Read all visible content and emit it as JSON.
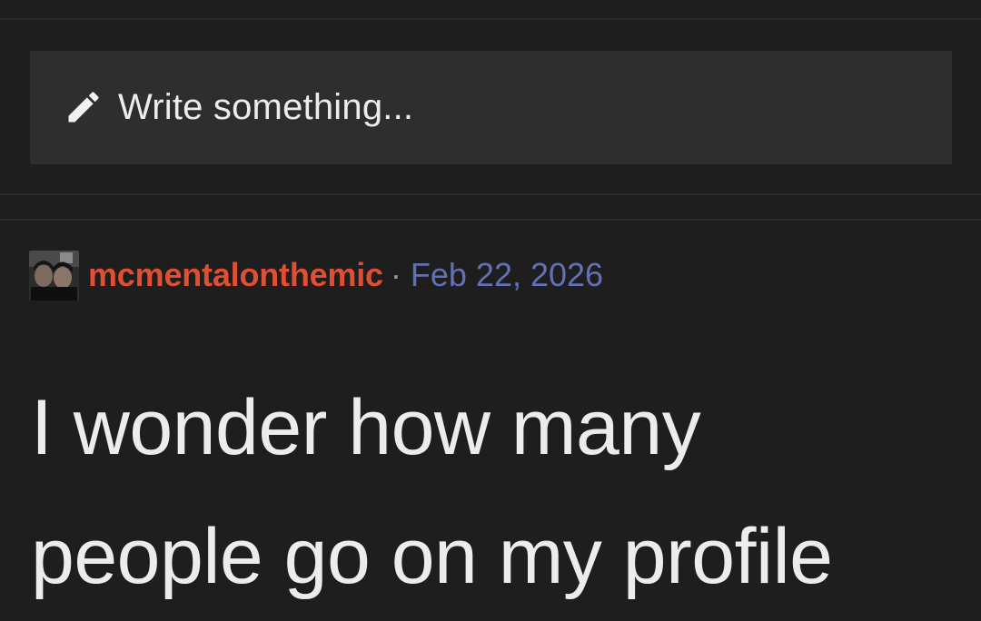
{
  "composer": {
    "placeholder": "Write something...",
    "icon": "pencil-icon"
  },
  "post": {
    "author": "mcmentalonthemic",
    "separator": "·",
    "date": "Feb 22, 2026",
    "text_lines": [
      "I wonder how many",
      "people go on my profile"
    ],
    "avatar": "user-avatar-photo"
  },
  "colors": {
    "background": "#1e1e1e",
    "composer_bg": "#2e2e2e",
    "username": "#e04f34",
    "date": "#6470b4",
    "text": "#ececec"
  }
}
